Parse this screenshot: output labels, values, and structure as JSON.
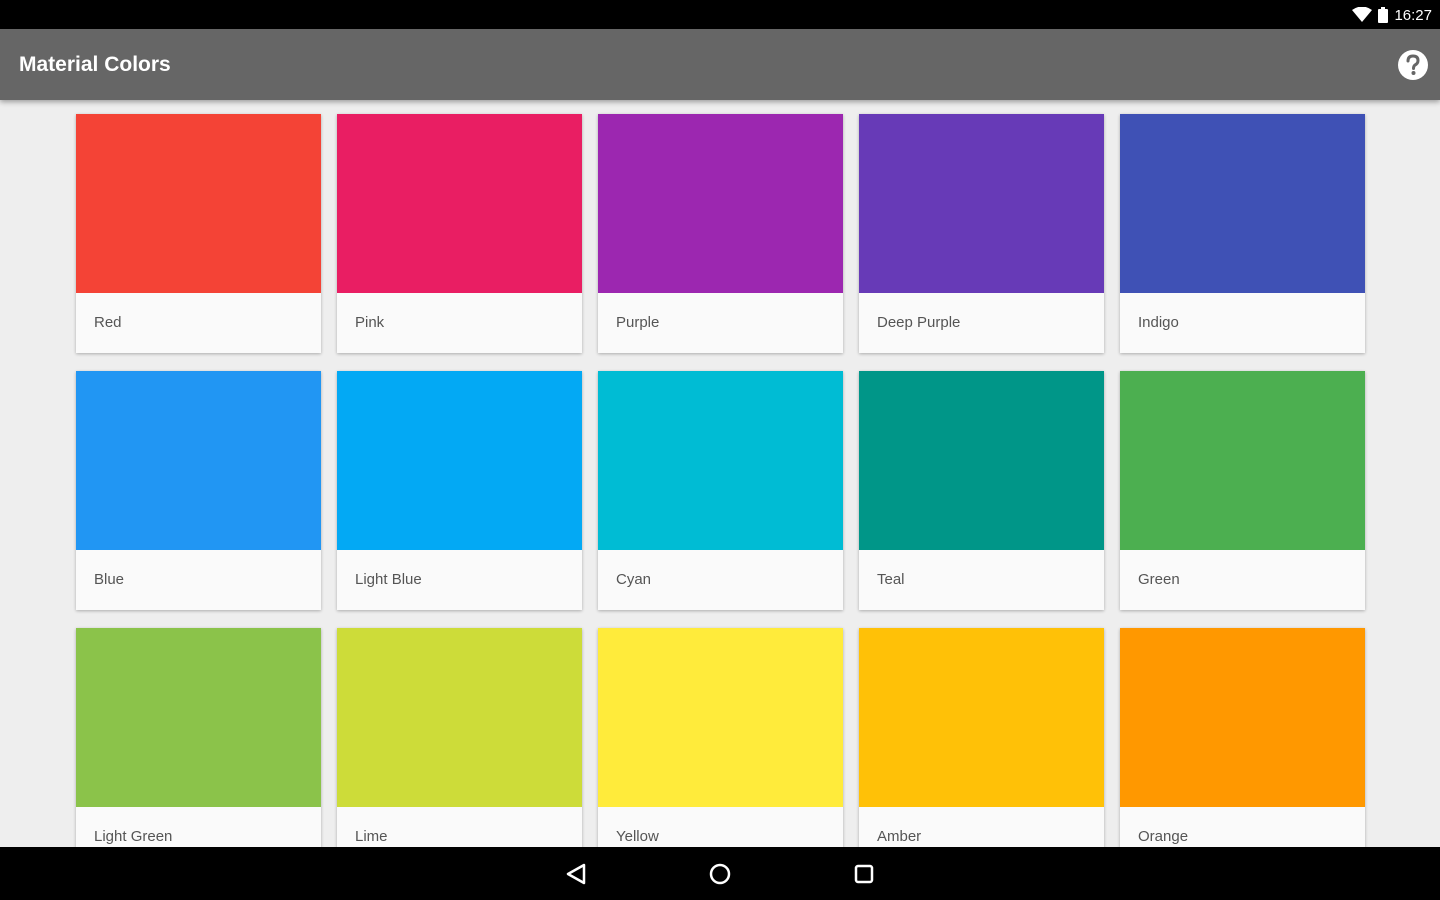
{
  "status_bar": {
    "time": "16:27"
  },
  "app_bar": {
    "title": "Material Colors",
    "help_icon": "help-circle-icon"
  },
  "colors": [
    {
      "name": "Red",
      "hex": "#F44336"
    },
    {
      "name": "Pink",
      "hex": "#E91E63"
    },
    {
      "name": "Purple",
      "hex": "#9C27B0"
    },
    {
      "name": "Deep Purple",
      "hex": "#673AB7"
    },
    {
      "name": "Indigo",
      "hex": "#3F51B5"
    },
    {
      "name": "Blue",
      "hex": "#2196F3"
    },
    {
      "name": "Light Blue",
      "hex": "#03A9F4"
    },
    {
      "name": "Cyan",
      "hex": "#00BCD4"
    },
    {
      "name": "Teal",
      "hex": "#009688"
    },
    {
      "name": "Green",
      "hex": "#4CAF50"
    },
    {
      "name": "Light Green",
      "hex": "#8BC34A"
    },
    {
      "name": "Lime",
      "hex": "#CDDC39"
    },
    {
      "name": "Yellow",
      "hex": "#FFEB3B"
    },
    {
      "name": "Amber",
      "hex": "#FFC107"
    },
    {
      "name": "Orange",
      "hex": "#FF9800"
    }
  ],
  "nav_bar": {
    "back_icon": "back-icon",
    "home_icon": "home-icon",
    "recents_icon": "recents-icon"
  }
}
